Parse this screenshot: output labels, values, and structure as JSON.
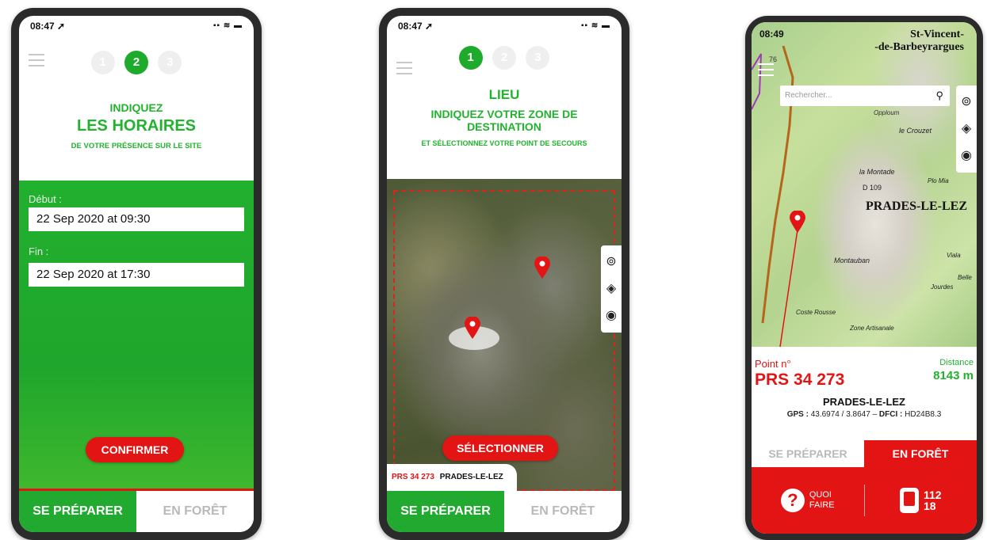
{
  "screen1": {
    "status_time": "08:47 ➚",
    "status_icons": "▪▪ ≋ ▬",
    "steps": [
      "1",
      "2",
      "3"
    ],
    "heading1": "INDIQUEZ",
    "heading2": "LES HORAIRES",
    "heading3": "DE VOTRE PRÉSENCE SUR LE SITE",
    "start_label": "Début :",
    "start_value": "22 Sep 2020 at 09:30",
    "end_label": "Fin :",
    "end_value": "22 Sep 2020 at 17:30",
    "confirm_label": "CONFIRMER",
    "tab_prepare": "SE PRÉPARER",
    "tab_forest": "EN FORÊT"
  },
  "screen2": {
    "status_time": "08:47 ➚",
    "status_icons": "▪▪ ≋ ▬",
    "steps": [
      "1",
      "2",
      "3"
    ],
    "heading1": "LIEU",
    "heading2": "INDIQUEZ VOTRE ZONE DE DESTINATION",
    "heading3": "ET SÉLECTIONNEZ VOTRE POINT DE SECOURS",
    "select_label": "SÉLECTIONNER",
    "point_code": "PRS 34 273",
    "point_town": "PRADES-LE-LEZ",
    "tab_prepare": "SE PRÉPARER",
    "tab_forest": "EN FORÊT"
  },
  "screen3": {
    "status_time": "08:49",
    "map_labels": {
      "town1a": "St-Vincent-",
      "town1b": "-de-Barbeyrargues",
      "town2": "PRADES-LE-LEZ",
      "place1": "le Crouzet",
      "place2": "la Montade",
      "place3": "Montauban",
      "place4": "Coste Rousse",
      "place5": "Zone Artisanale",
      "road": "D 109",
      "misc1": "76",
      "misc2": "Plo Mia",
      "misc3": "Viala",
      "misc4": "Belle",
      "misc5": "Jourdes",
      "misc6": "Opploum"
    },
    "search_placeholder": "Rechercher...",
    "point_label": "Point n°",
    "point_code": "PRS 34 273",
    "distance_label": "Distance",
    "distance_value": "8143 m",
    "town": "PRADES-LE-LEZ",
    "gps_label": "GPS :",
    "gps_value": "43.6974 / 3.8647",
    "dfci_label": "DFCI :",
    "dfci_value": "HD24B8.3",
    "tab_prepare": "SE PRÉPARER",
    "tab_forest": "EN FORÊT",
    "help_label1": "QUOI",
    "help_label2": "FAIRE",
    "emergency1": "112",
    "emergency2": "18"
  },
  "colors": {
    "green": "#21b32d",
    "red": "#e31414"
  }
}
